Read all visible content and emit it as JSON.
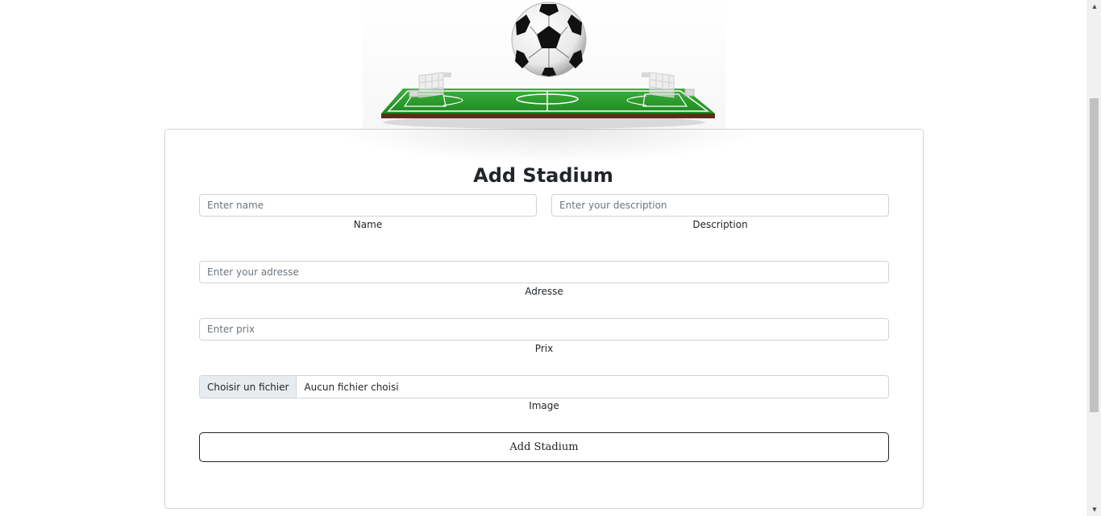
{
  "hero": {
    "icon": "soccer-stadium-image"
  },
  "form": {
    "title": "Add Stadium",
    "name": {
      "placeholder": "Enter name",
      "value": "",
      "label": "Name"
    },
    "description": {
      "placeholder": "Enter your description",
      "value": "",
      "label": "Description"
    },
    "adresse": {
      "placeholder": "Enter your adresse",
      "value": "",
      "label": "Adresse"
    },
    "prix": {
      "placeholder": "Enter prix",
      "value": "",
      "label": "Prix"
    },
    "image": {
      "button_label": "Choisir un fichier",
      "file_name": "Aucun fichier choisi",
      "label": "Image"
    },
    "submit_label": "Add Stadium"
  },
  "colors": {
    "field_green": "#2e9a2e",
    "field_border": "#5a2e1a",
    "input_border": "#ced4da",
    "file_button_bg": "#e9ecef"
  }
}
